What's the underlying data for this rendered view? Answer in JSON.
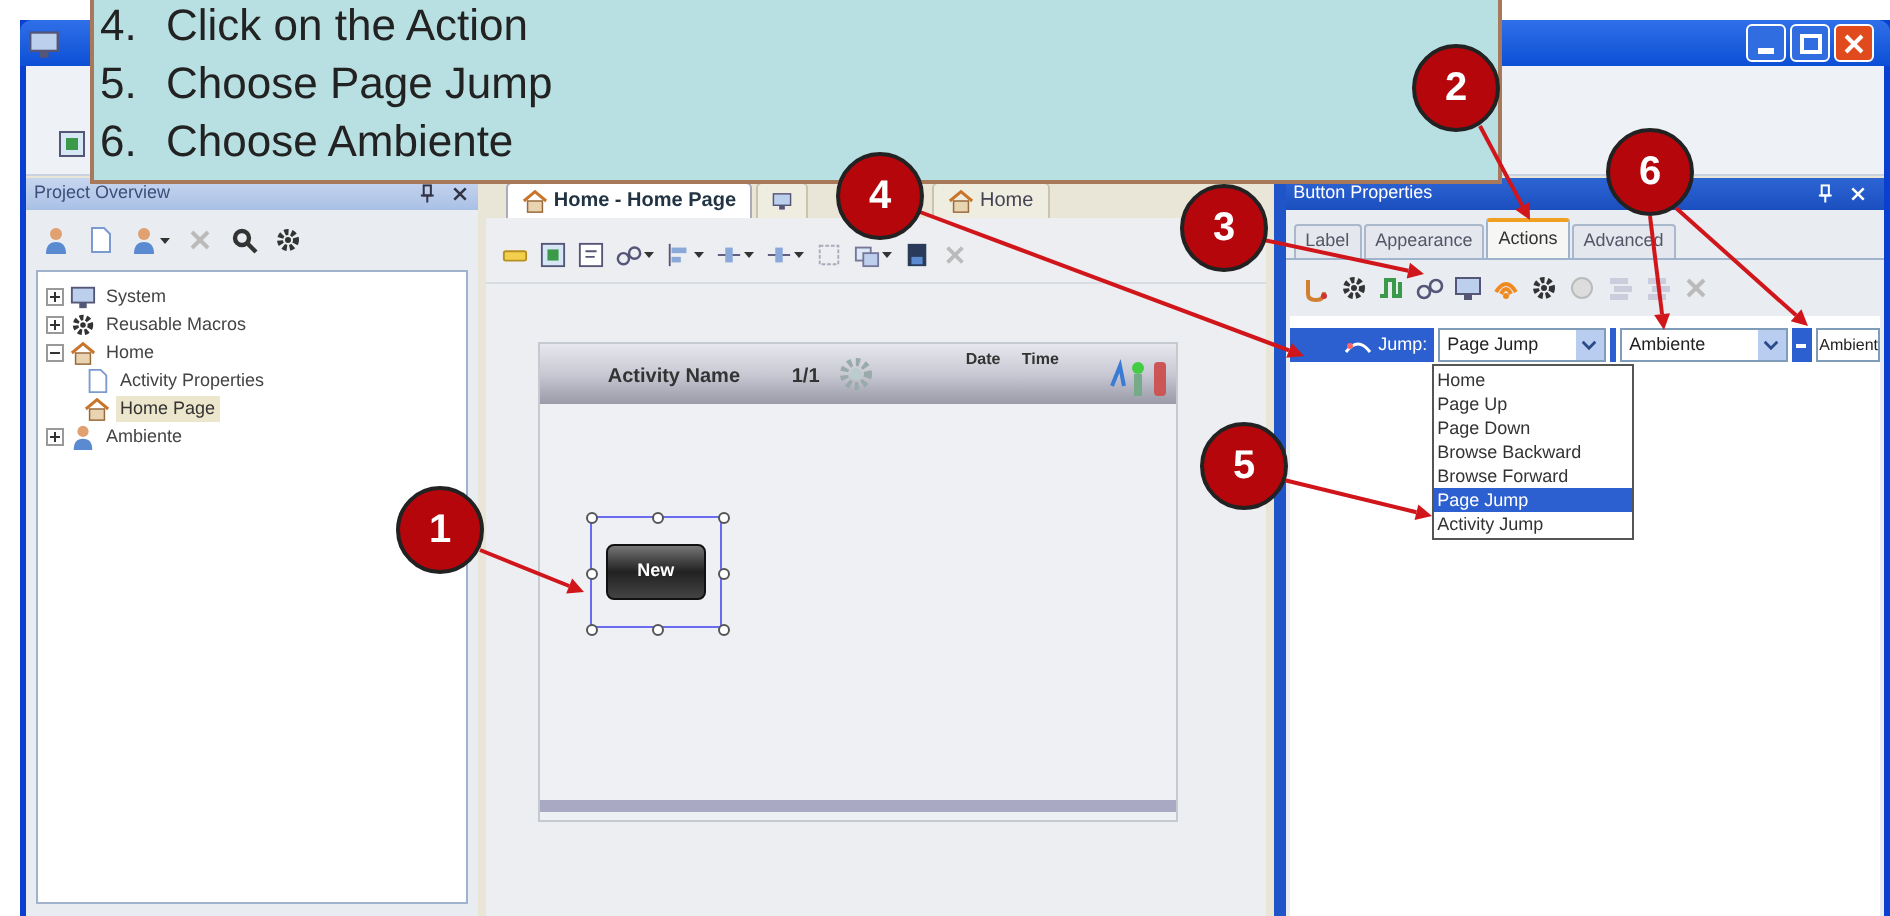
{
  "instructions": [
    {
      "number": "4.",
      "text": "Click on the Action"
    },
    {
      "number": "5.",
      "text": "Choose Page Jump"
    },
    {
      "number": "6.",
      "text": "Choose Ambiente"
    }
  ],
  "callouts": [
    {
      "number": "1"
    },
    {
      "number": "2"
    },
    {
      "number": "3"
    },
    {
      "number": "4"
    },
    {
      "number": "5"
    },
    {
      "number": "6"
    }
  ],
  "project_overview": {
    "title": "Project Overview",
    "tree": [
      {
        "label": "System",
        "expanded": false,
        "selected": false
      },
      {
        "label": "Reusable Macros",
        "expanded": false,
        "selected": false
      },
      {
        "label": "Home",
        "expanded": true,
        "selected": false,
        "children": [
          {
            "label": "Activity Properties",
            "selected": false
          },
          {
            "label": "Home Page",
            "selected": true
          }
        ]
      },
      {
        "label": "Ambiente",
        "expanded": false,
        "selected": false
      }
    ]
  },
  "editor": {
    "tabs": [
      {
        "label": "Home - Home Page",
        "selected": true
      },
      {
        "selected": false
      },
      {
        "label": "Home",
        "selected": false
      }
    ],
    "screen": {
      "activity_name": "Activity Name",
      "page": "1/1",
      "date": "Date",
      "time": "Time",
      "button": "New"
    }
  },
  "properties": {
    "title": "Button Properties",
    "tabs": [
      {
        "label": "Label",
        "selected": false
      },
      {
        "label": "Appearance",
        "selected": false
      },
      {
        "label": "Actions",
        "selected": true
      },
      {
        "label": "Advanced",
        "selected": false
      }
    ],
    "jump_label": "Jump:",
    "action": "Page Jump",
    "target": "Ambiente",
    "target_2": "Ambient",
    "options": [
      {
        "label": "Home",
        "selected": false
      },
      {
        "label": "Page Up",
        "selected": false
      },
      {
        "label": "Page Down",
        "selected": false
      },
      {
        "label": "Browse Backward",
        "selected": false
      },
      {
        "label": "Browse Forward",
        "selected": false
      },
      {
        "label": "Page Jump",
        "selected": true
      },
      {
        "label": "Activity Jump",
        "selected": false
      }
    ]
  }
}
